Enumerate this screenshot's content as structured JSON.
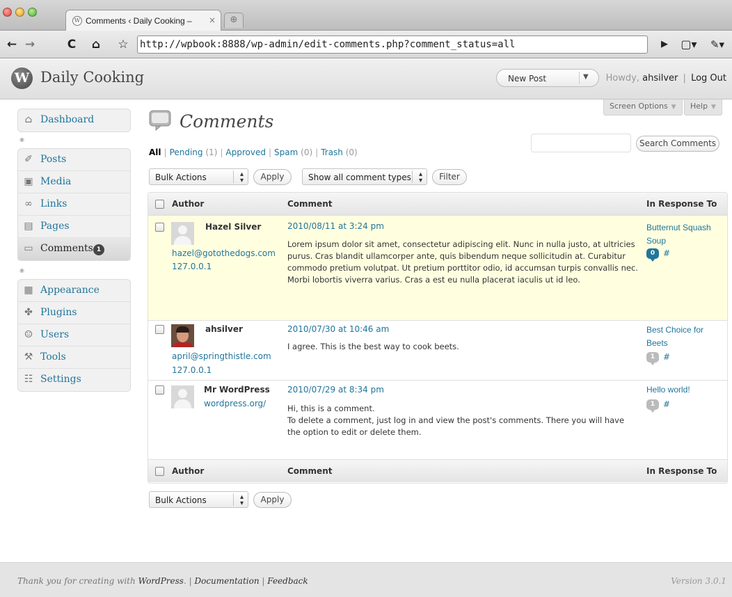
{
  "browser": {
    "tab_title": "Comments ‹ Daily Cooking –",
    "tab_close": "×",
    "url": "http://wpbook:8888/wp-admin/edit-comments.php?comment_status=all"
  },
  "header": {
    "logo_glyph": "W",
    "site_title": "Daily Cooking",
    "new_post_label": "New Post",
    "howdy_prefix": "Howdy,",
    "username": "ahsilver",
    "separator": "|",
    "logout_label": "Log Out"
  },
  "screen_meta": {
    "screen_options": "Screen Options",
    "help": "Help"
  },
  "sidebar": {
    "items": [
      {
        "label": "Dashboard",
        "icon": "house-icon"
      },
      {
        "label": "Posts",
        "icon": "pushpin-icon"
      },
      {
        "label": "Media",
        "icon": "media-icon"
      },
      {
        "label": "Links",
        "icon": "link-icon"
      },
      {
        "label": "Pages",
        "icon": "pages-icon"
      },
      {
        "label": "Comments",
        "icon": "comment-bubble-icon",
        "badge": "1"
      },
      {
        "label": "Appearance",
        "icon": "appearance-icon"
      },
      {
        "label": "Plugins",
        "icon": "plug-icon"
      },
      {
        "label": "Users",
        "icon": "users-icon"
      },
      {
        "label": "Tools",
        "icon": "tools-icon"
      },
      {
        "label": "Settings",
        "icon": "settings-icon"
      }
    ]
  },
  "main": {
    "page_title": "Comments",
    "filters": {
      "all": "All",
      "pending": "Pending",
      "pending_count": "(1)",
      "approved": "Approved",
      "spam": "Spam",
      "spam_count": "(0)",
      "trash": "Trash",
      "trash_count": "(0)",
      "bar": "|"
    },
    "search_value": "",
    "search_button": "Search Comments",
    "bulk_actions": "Bulk Actions",
    "apply": "Apply",
    "comment_types": "Show all comment types",
    "filter_button": "Filter"
  },
  "table": {
    "headers": {
      "author": "Author",
      "comment": "Comment",
      "in_response_to": "In Response To"
    },
    "rows": [
      {
        "author": "Hazel Silver",
        "email": "hazel@gotothedogs.com",
        "ip": "127.0.0.1",
        "date": "2010/08/11 at 3:24 pm",
        "text": "Lorem ipsum dolor sit amet, consectetur adipiscing elit. Nunc in nulla justo, at ultricies purus. Cras blandit ullamcorper ante, quis bibendum neque sollicitudin at. Curabitur commodo pretium volutpat. Ut pretium porttitor odio, id accumsan turpis convallis nec. Morbi lobortis viverra varius. Cras a est eu nulla placerat iaculis ut id leo.",
        "post": "Butternut Squash Soup",
        "count": "0",
        "hash": "#",
        "status": "unapproved"
      },
      {
        "author": "ahsilver",
        "email": "april@springthistle.com",
        "ip": "127.0.0.1",
        "date": "2010/07/30 at 10:46 am",
        "text": "I agree. This is the best way to cook beets.",
        "post": "Best Choice for Beets",
        "count": "1",
        "hash": "#",
        "status": "approved"
      },
      {
        "author": "Mr WordPress",
        "url": "wordpress.org/",
        "date": "2010/07/29 at 8:34 pm",
        "text_line1": "Hi, this is a comment.",
        "text_line2": "To delete a comment, just log in and view the post's comments. There you will have the option to edit or delete them.",
        "post": "Hello world!",
        "count": "1",
        "hash": "#",
        "status": "approved"
      }
    ]
  },
  "footer": {
    "thanks": "Thank you for creating with",
    "wordpress": "WordPress",
    "documentation": "Documentation",
    "feedback": "Feedback",
    "version": "Version 3.0.1",
    "separator": "|"
  },
  "colors": {
    "link": "#21759b",
    "unapproved_bg": "#ffffe0",
    "badge": "#464646"
  }
}
